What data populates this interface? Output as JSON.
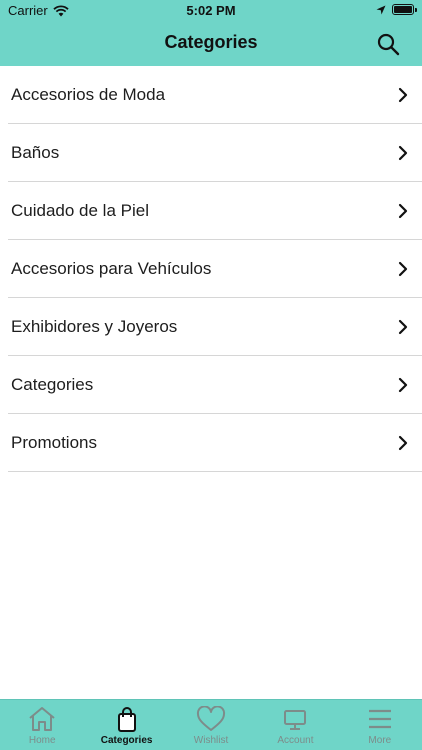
{
  "status": {
    "carrier": "Carrier",
    "time": "5:02 PM"
  },
  "header": {
    "title": "Categories"
  },
  "categories": [
    {
      "label": "Accesorios de Moda"
    },
    {
      "label": "Baños"
    },
    {
      "label": "Cuidado de la Piel"
    },
    {
      "label": "Accesorios para Vehículos"
    },
    {
      "label": "Exhibidores y Joyeros"
    },
    {
      "label": "Categories"
    },
    {
      "label": "Promotions"
    }
  ],
  "tabs": [
    {
      "label": "Home",
      "icon": "home-icon",
      "active": false
    },
    {
      "label": "Categories",
      "icon": "shopping-bag-icon",
      "active": true
    },
    {
      "label": "Wishlist",
      "icon": "heart-icon",
      "active": false
    },
    {
      "label": "Account",
      "icon": "monitor-icon",
      "active": false
    },
    {
      "label": "More",
      "icon": "menu-icon",
      "active": false
    }
  ],
  "colors": {
    "header_bg": "#6fd5c8",
    "tabbar_bg": "#6fd5c8",
    "divider": "#d6d6d6",
    "inactive_tab": "#7d8c8a"
  }
}
